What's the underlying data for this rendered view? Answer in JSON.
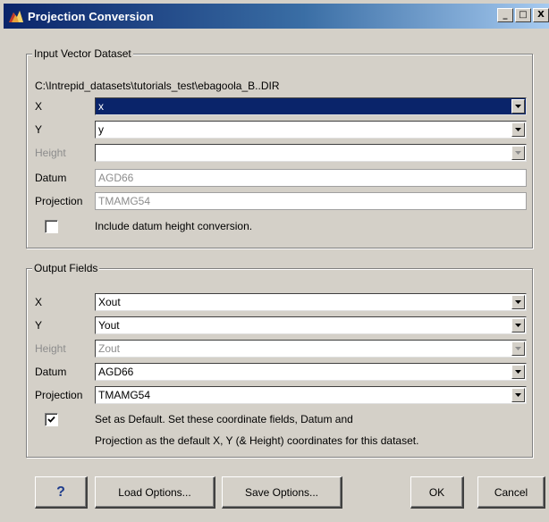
{
  "window": {
    "title": "Projection Conversion",
    "buttons": {
      "minimize": "_",
      "maximize": "□",
      "close": "X"
    }
  },
  "input_group": {
    "legend": "Input Vector Dataset",
    "path": "C:\\Intrepid_datasets\\tutorials_test\\ebagoola_B..DIR",
    "x_label": "X",
    "x_value": "x",
    "y_label": "Y",
    "y_value": "y",
    "height_label": "Height",
    "height_value": "",
    "datum_label": "Datum",
    "datum_value": "AGD66",
    "projection_label": "Projection",
    "projection_value": "TMAMG54",
    "datum_height_checkbox_label": "Include datum height conversion.",
    "datum_height_checked": false
  },
  "output_group": {
    "legend": "Output Fields",
    "x_label": "X",
    "x_value": "Xout",
    "y_label": "Y",
    "y_value": "Yout",
    "height_label": "Height",
    "height_value": "Zout",
    "datum_label": "Datum",
    "datum_value": "AGD66",
    "projection_label": "Projection",
    "projection_value": "TMAMG54",
    "default_checkbox_line1": "Set as Default. Set these coordinate fields, Datum and",
    "default_checkbox_line2": "Projection as the default X, Y (& Height) coordinates for this dataset.",
    "default_checked": true
  },
  "footer": {
    "help_label": "?",
    "load_label": "Load Options...",
    "save_label": "Save Options...",
    "ok_label": "OK",
    "cancel_label": "Cancel"
  },
  "colors": {
    "titlebar_start": "#0a246a",
    "titlebar_end": "#a6caf0",
    "selection": "#0a246a",
    "face": "#d4d0c8"
  }
}
